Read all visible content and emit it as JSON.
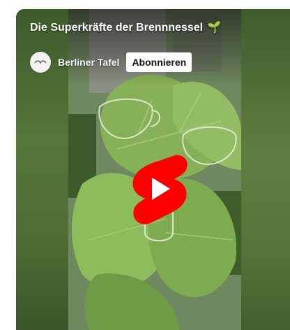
{
  "video": {
    "title": "Die Superkräfte der Brennnessel",
    "title_emoji": "🌱",
    "channel_name": "Berliner Tafel",
    "subscribe_label": "Abonnieren",
    "avatar_icon": "berliner-tafel-logo",
    "play_icon": "youtube-shorts-play-icon"
  },
  "colors": {
    "shorts_red": "#ff0000",
    "leaf_green": "#7fa552",
    "white": "#ffffff"
  }
}
